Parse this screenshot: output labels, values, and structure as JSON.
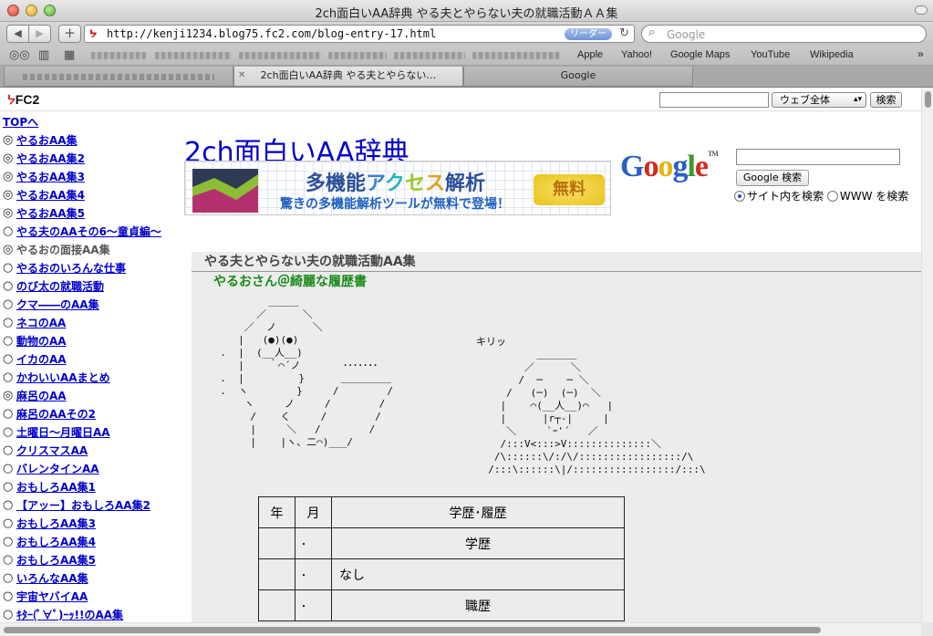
{
  "window": {
    "title": "2ch面白いAA辞典 やる夫とやらない夫の就職活動ＡＡ集"
  },
  "toolbar": {
    "back_glyph": "◀",
    "forward_glyph": "▶",
    "add_glyph": "+",
    "url": "http://kenji1234.blog75.fc2.com/blog-entry-17.html",
    "reader_label": "リーダー",
    "reload_glyph": "↻",
    "search_placeholder": "Google"
  },
  "bookmarks": {
    "items": [
      "Apple",
      "Yahoo!",
      "Google Maps",
      "YouTube",
      "Wikipedia"
    ]
  },
  "tabs": [
    {
      "label": "2ch面白いAA辞典 やる夫とやらない…",
      "active": true
    },
    {
      "label": "Google",
      "active": false
    }
  ],
  "fc2": {
    "logo": "FC2",
    "scope_select": "ウェブ全体",
    "search_button": "検索"
  },
  "sidebar": {
    "top_link": "TOPへ",
    "items": [
      {
        "mark": "◎",
        "label": "やるおAA集",
        "visited": false
      },
      {
        "mark": "◎",
        "label": "やるおAA集2",
        "visited": false
      },
      {
        "mark": "◎",
        "label": "やるおAA集3",
        "visited": false
      },
      {
        "mark": "◎",
        "label": "やるおAA集4",
        "visited": false
      },
      {
        "mark": "◎",
        "label": "やるおAA集5",
        "visited": false
      },
      {
        "mark": "○",
        "label": "やる夫のAAその6〜童貞編〜",
        "visited": false
      },
      {
        "mark": "◎",
        "label": "やるおの面接AA集",
        "visited": true
      },
      {
        "mark": "○",
        "label": "やるおのいろんな仕事",
        "visited": false
      },
      {
        "mark": "○",
        "label": "のび太の就職活動",
        "visited": false
      },
      {
        "mark": "○",
        "label": "クマ――のAA集",
        "visited": false
      },
      {
        "mark": "○",
        "label": "ネコのAA",
        "visited": false
      },
      {
        "mark": "○",
        "label": "動物のAA",
        "visited": false
      },
      {
        "mark": "○",
        "label": "イカのAA",
        "visited": false
      },
      {
        "mark": "○",
        "label": "かわいいAAまとめ",
        "visited": false
      },
      {
        "mark": "◎",
        "label": "麻呂のAA",
        "visited": false
      },
      {
        "mark": "○",
        "label": "麻呂のAAその2",
        "visited": false
      },
      {
        "mark": "○",
        "label": "土曜日〜月曜日AA",
        "visited": false
      },
      {
        "mark": "○",
        "label": "クリスマスAA",
        "visited": false
      },
      {
        "mark": "○",
        "label": "バレンタインAA",
        "visited": false
      },
      {
        "mark": "○",
        "label": "おもしろAA集1",
        "visited": false
      },
      {
        "mark": "○",
        "label": "【アッー】おもしろAA集2",
        "visited": false
      },
      {
        "mark": "○",
        "label": "おもしろAA集3",
        "visited": false
      },
      {
        "mark": "○",
        "label": "おもしろAA集4",
        "visited": false
      },
      {
        "mark": "○",
        "label": "おもしろAA集5",
        "visited": false
      },
      {
        "mark": "○",
        "label": "いろんなAA集",
        "visited": false
      },
      {
        "mark": "○",
        "label": "宇宙ヤバイAA",
        "visited": false
      },
      {
        "mark": "○",
        "label": "ｷﾀｰ(ﾟ∀ﾟ)ｰｯ!!のAA集",
        "visited": false
      }
    ]
  },
  "blog": {
    "title": "2ch面白いAA辞典"
  },
  "banner": {
    "headline_parts": [
      "多機能",
      "ア",
      "ク",
      "セ",
      "ス",
      "解析"
    ],
    "subline": "驚きの多機能解析ツールが無料で登場！",
    "badge": "無料"
  },
  "google": {
    "logo_letters": [
      "G",
      "o",
      "o",
      "g",
      "l",
      "e"
    ],
    "tm": "TM",
    "search_button": "Google 検索",
    "radio_site": "サイト内を検索",
    "radio_www": "WWW を検索"
  },
  "entry": {
    "title": "やる夫とやらない夫の就職活動AA集",
    "subtitle": "やるおさん＠綺麗な履歴書",
    "aa_left": "          ＿＿＿\n        ／      ＼\n      ／  ノ      ＼\n     |   (●)(●)\n  .  |  (__人__)\n     |    ｀⌒´ノ       ･･･････\n  .  |         }      ＿＿＿＿＿\n  .  ヽ        }     /        /\n      ヽ     ノ     /        /\n       /    く     /        /\n       |     ＼   /        /\n       |    |ヽ、二⌒)___/",
    "aa_right": "キリッ\n          ＿＿＿＿\n        ／      ＼\n       /  ─    ─ ＼\n     /   (─)  (─)  ＼\n    |    ⌒(__人__)⌒   |\n    |      |r┬-|     |\n     ＼     `ｰ'´   ／\n    /:::V<:::>V::::::::::::::＼\n   /\\::::::\\/:/\\/:::::::::::::::::/\\\n  /:::\\::::::\\|/:::::::::::::::::/:::\\",
    "resume": {
      "headers": [
        "年",
        "月",
        "学歴･履歴"
      ],
      "rows": [
        {
          "year": "",
          "month": "",
          "text": "学歴",
          "center": true
        },
        {
          "year": "",
          "month": "",
          "text": "なし",
          "center": false
        },
        {
          "year": "",
          "month": "",
          "text": "職歴",
          "center": true
        }
      ]
    }
  }
}
